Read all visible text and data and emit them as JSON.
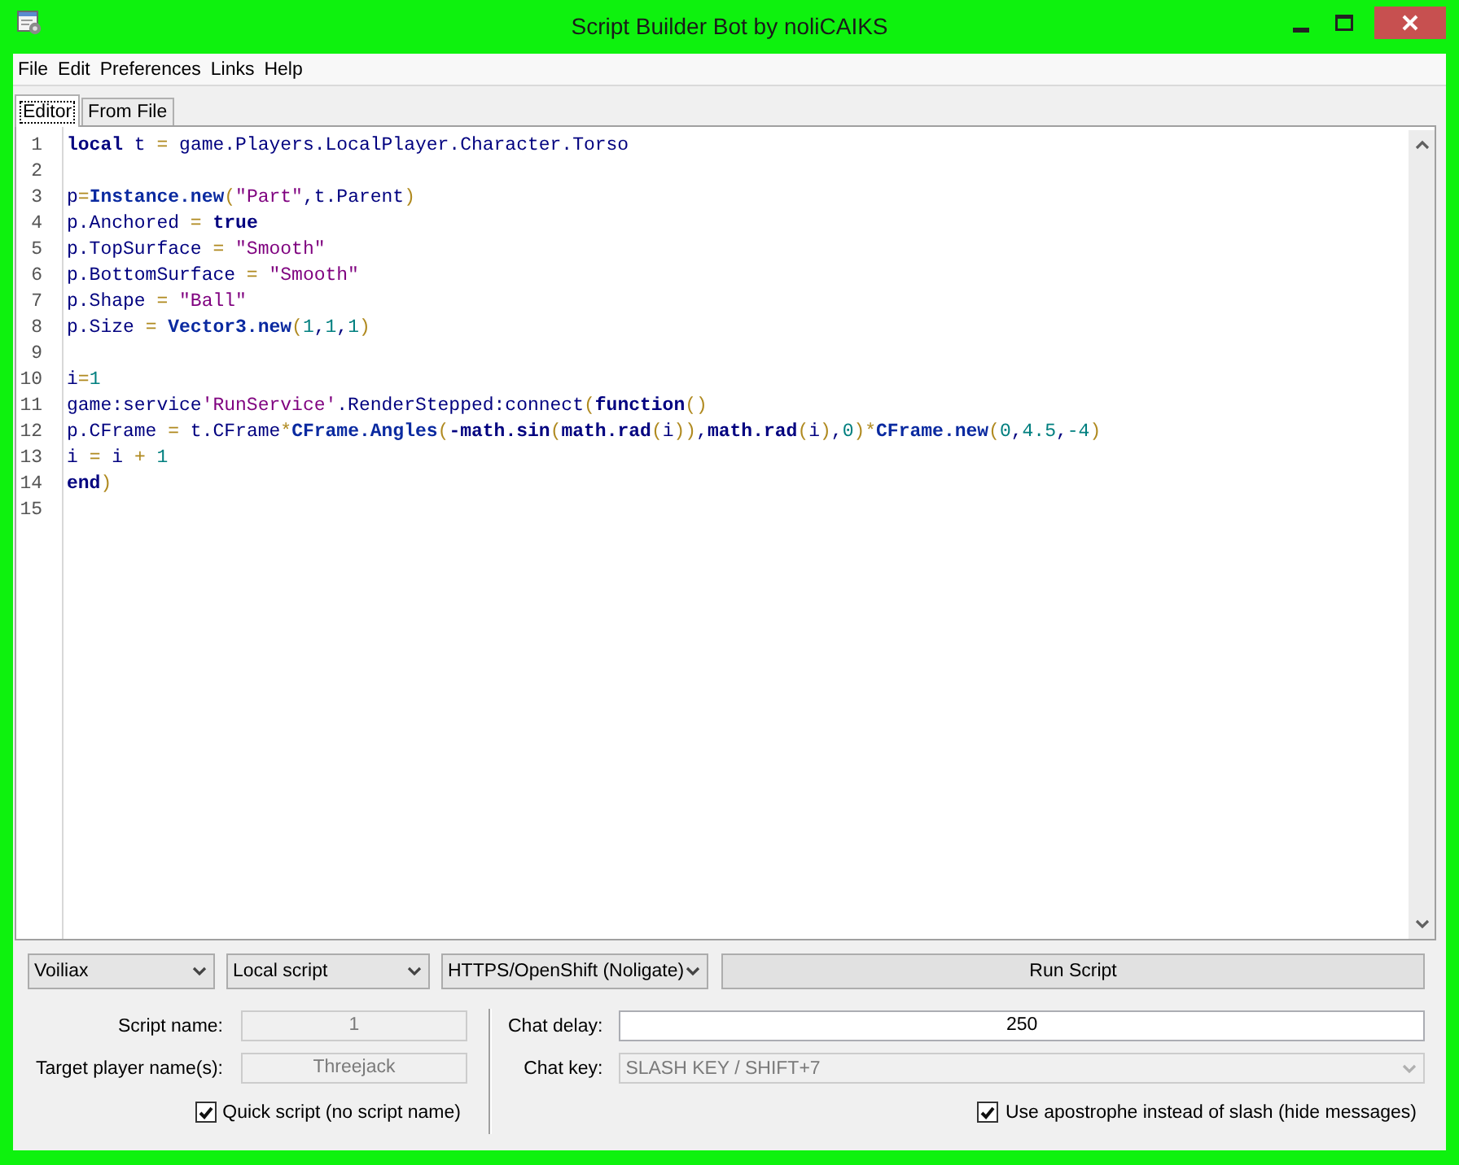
{
  "window": {
    "title": "Script Builder Bot by noliCAIKS"
  },
  "menu": [
    {
      "label": "File"
    },
    {
      "label": "Edit"
    },
    {
      "label": "Preferences"
    },
    {
      "label": "Links"
    },
    {
      "label": "Help"
    }
  ],
  "tabs": [
    {
      "label": "Editor",
      "selected": true
    },
    {
      "label": "From File",
      "selected": false
    }
  ],
  "editor": {
    "lines": [
      {
        "number": "1",
        "tokens": [
          {
            "kind": "keyword",
            "text": "local"
          },
          {
            "kind": "text",
            "text": " t "
          },
          {
            "kind": "operator",
            "text": "="
          },
          {
            "kind": "text",
            "text": " game.Players.LocalPlayer.Character.Torso"
          }
        ]
      },
      {
        "number": "2"
      },
      {
        "number": "3",
        "tokens": [
          {
            "kind": "text",
            "text": "p"
          },
          {
            "kind": "operator",
            "text": "="
          },
          {
            "kind": "builtin",
            "text": "Instance.new"
          },
          {
            "kind": "operator",
            "text": "("
          },
          {
            "kind": "string",
            "text": "\"Part\""
          },
          {
            "kind": "text",
            "text": ",t.Parent"
          },
          {
            "kind": "operator",
            "text": ")"
          }
        ]
      },
      {
        "number": "4",
        "tokens": [
          {
            "kind": "text",
            "text": "p.Anchored "
          },
          {
            "kind": "operator",
            "text": "= "
          },
          {
            "kind": "keyword",
            "text": "true"
          }
        ]
      },
      {
        "number": "5",
        "tokens": [
          {
            "kind": "text",
            "text": "p.TopSurface "
          },
          {
            "kind": "operator",
            "text": "= "
          },
          {
            "kind": "string",
            "text": "\"Smooth\""
          }
        ]
      },
      {
        "number": "6",
        "tokens": [
          {
            "kind": "text",
            "text": "p.BottomSurface "
          },
          {
            "kind": "operator",
            "text": "= "
          },
          {
            "kind": "string",
            "text": "\"Smooth\""
          }
        ]
      },
      {
        "number": "7",
        "tokens": [
          {
            "kind": "text",
            "text": "p.Shape "
          },
          {
            "kind": "operator",
            "text": "= "
          },
          {
            "kind": "string",
            "text": "\"Ball\""
          }
        ]
      },
      {
        "number": "8",
        "tokens": [
          {
            "kind": "text",
            "text": "p.Size "
          },
          {
            "kind": "operator",
            "text": "= "
          },
          {
            "kind": "builtin",
            "text": "Vector3.new"
          },
          {
            "kind": "operator",
            "text": "("
          },
          {
            "kind": "number",
            "text": "1"
          },
          {
            "kind": "text",
            "text": ","
          },
          {
            "kind": "number",
            "text": "1"
          },
          {
            "kind": "text",
            "text": ","
          },
          {
            "kind": "number",
            "text": "1"
          },
          {
            "kind": "operator",
            "text": ")"
          }
        ]
      },
      {
        "number": "9"
      },
      {
        "number": "10",
        "tokens": [
          {
            "kind": "text",
            "text": "i"
          },
          {
            "kind": "operator",
            "text": "="
          },
          {
            "kind": "number",
            "text": "1"
          }
        ]
      },
      {
        "number": "11",
        "tokens": [
          {
            "kind": "text",
            "text": "game:service"
          },
          {
            "kind": "string",
            "text": "'RunService'"
          },
          {
            "kind": "text",
            "text": ".RenderStepped:connect"
          },
          {
            "kind": "operator",
            "text": "("
          },
          {
            "kind": "keyword",
            "text": "function"
          },
          {
            "kind": "operator",
            "text": "()"
          }
        ]
      },
      {
        "number": "12",
        "tokens": [
          {
            "kind": "text",
            "text": "p.CFrame "
          },
          {
            "kind": "operator",
            "text": "="
          },
          {
            "kind": "text",
            "text": " t.CFrame"
          },
          {
            "kind": "operator",
            "text": "*"
          },
          {
            "kind": "builtin",
            "text": "CFrame.Angles"
          },
          {
            "kind": "operator",
            "text": "("
          },
          {
            "kind": "keyword",
            "text": "-math.sin"
          },
          {
            "kind": "operator",
            "text": "("
          },
          {
            "kind": "keyword",
            "text": "math.rad"
          },
          {
            "kind": "operator",
            "text": "("
          },
          {
            "kind": "text",
            "text": "i"
          },
          {
            "kind": "operator",
            "text": "))"
          },
          {
            "kind": "text",
            "text": ","
          },
          {
            "kind": "keyword",
            "text": "math.rad"
          },
          {
            "kind": "operator",
            "text": "("
          },
          {
            "kind": "text",
            "text": "i"
          },
          {
            "kind": "operator",
            "text": ")"
          },
          {
            "kind": "text",
            "text": ","
          },
          {
            "kind": "number",
            "text": "0"
          },
          {
            "kind": "operator",
            "text": ")*"
          },
          {
            "kind": "builtin",
            "text": "CFrame.new"
          },
          {
            "kind": "operator",
            "text": "("
          },
          {
            "kind": "number",
            "text": "0"
          },
          {
            "kind": "text",
            "text": ","
          },
          {
            "kind": "number",
            "text": "4.5"
          },
          {
            "kind": "text",
            "text": ","
          },
          {
            "kind": "number",
            "text": "-4"
          },
          {
            "kind": "operator",
            "text": ")"
          }
        ]
      },
      {
        "number": "13",
        "tokens": [
          {
            "kind": "text",
            "text": "i "
          },
          {
            "kind": "operator",
            "text": "="
          },
          {
            "kind": "text",
            "text": " i "
          },
          {
            "kind": "operator",
            "text": "+ "
          },
          {
            "kind": "number",
            "text": "1"
          }
        ]
      },
      {
        "number": "14",
        "tokens": [
          {
            "kind": "keyword",
            "text": "end"
          },
          {
            "kind": "operator",
            "text": ")"
          }
        ]
      },
      {
        "number": "15"
      }
    ]
  },
  "toolbar": {
    "selectors": [
      {
        "value": "Voiliax"
      },
      {
        "value": "Local script"
      },
      {
        "value": "HTTPS/OpenShift (Noligate)"
      }
    ],
    "run_button": {
      "label": "Run Script"
    }
  },
  "left": {
    "fields": [
      {
        "kind": "text",
        "label": "Script name:",
        "value": "1",
        "disabled": true
      },
      {
        "kind": "text",
        "label": "Target player name(s):",
        "value": "Threejack",
        "disabled": true
      }
    ],
    "checkbox": {
      "label": "Quick script (no script name)",
      "checked": true
    }
  },
  "right": {
    "fields": [
      {
        "kind": "text",
        "label": "Chat delay:",
        "value": "250",
        "disabled": false
      },
      {
        "kind": "dropdown",
        "label": "Chat key:",
        "value": "SLASH KEY / SHIFT+7",
        "disabled": true
      }
    ],
    "checkbox": {
      "label": "Use apostrophe instead of slash (hide messages)",
      "checked": true
    }
  }
}
